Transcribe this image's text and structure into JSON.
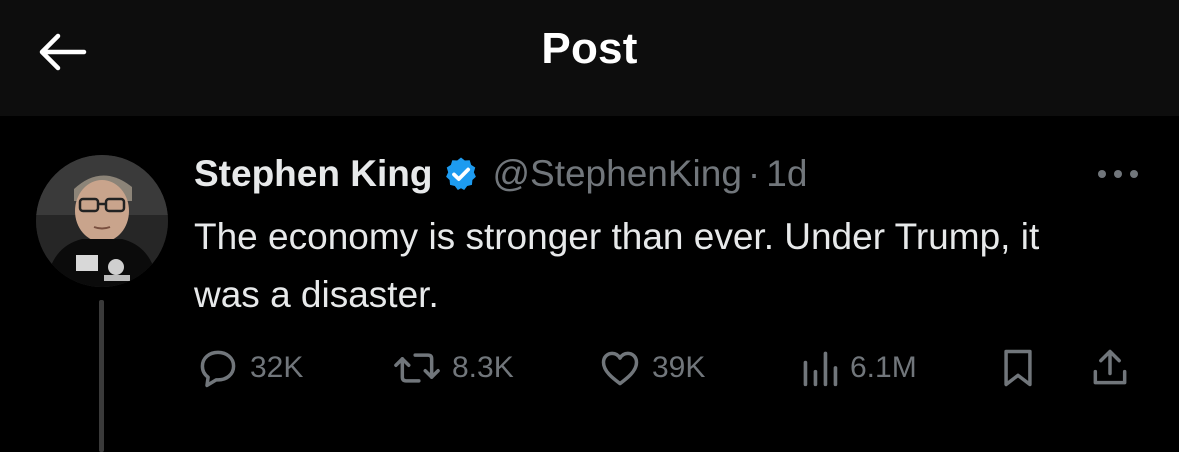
{
  "header": {
    "title": "Post",
    "back_icon": "arrow-left-icon"
  },
  "post": {
    "author_name": "Stephen King",
    "verified_icon": "verified-badge-icon",
    "verified_color": "#1d9bf0",
    "handle": "@StephenKing",
    "separator": "·",
    "time": "1d",
    "text": "The economy is stronger than ever. Under Trump, it was a disaster.",
    "more_icon": "more-horizontal-icon"
  },
  "actions": {
    "reply": {
      "icon": "reply-icon",
      "count": "32K"
    },
    "repost": {
      "icon": "repost-icon",
      "count": "8.3K"
    },
    "like": {
      "icon": "heart-icon",
      "count": "39K"
    },
    "views": {
      "icon": "views-bar-chart-icon",
      "count": "6.1M"
    },
    "bookmark": {
      "icon": "bookmark-icon"
    },
    "share": {
      "icon": "share-icon"
    }
  },
  "colors": {
    "background": "#000000",
    "topbar": "#0d0d0d",
    "primary_text": "#e7e9ea",
    "secondary_text": "#71767b",
    "accent": "#1d9bf0"
  }
}
